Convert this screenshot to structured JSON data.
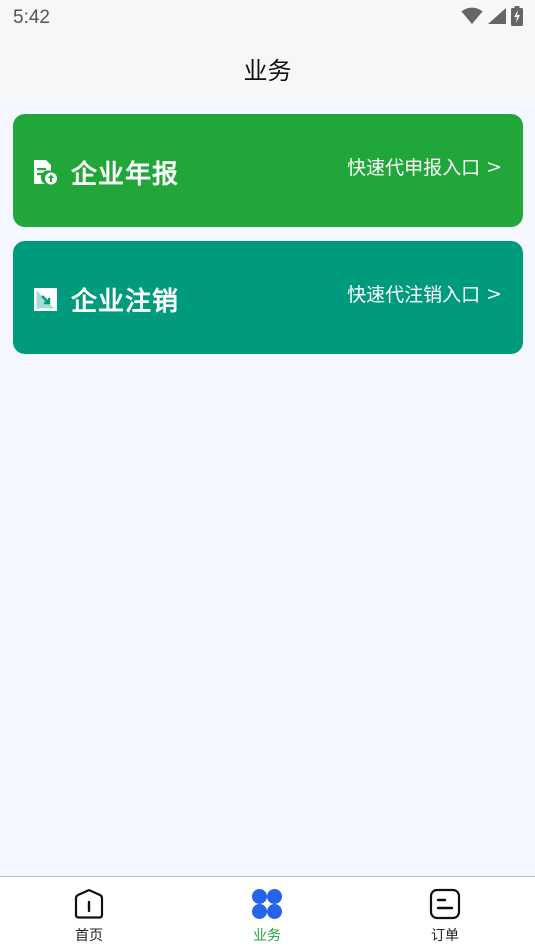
{
  "status_bar": {
    "time": "5:42",
    "icons": [
      "wifi-icon",
      "cellular-signal-icon",
      "battery-charging-icon"
    ]
  },
  "header": {
    "title": "业务"
  },
  "cards": [
    {
      "title": "企业年报",
      "link_label": "快速代申报入口",
      "chevron": ">",
      "icon": "report-upload-icon",
      "color": "#21a63a"
    },
    {
      "title": "企业注销",
      "link_label": "快速代注销入口",
      "chevron": ">",
      "icon": "deregister-icon",
      "color": "#009a7c"
    }
  ],
  "tab_bar": {
    "active_color": "#21a63a",
    "items": [
      {
        "label": "首页",
        "icon": "home-icon",
        "active": false
      },
      {
        "label": "业务",
        "icon": "business-grid-icon",
        "active": true
      },
      {
        "label": "订单",
        "icon": "orders-icon",
        "active": false
      }
    ]
  }
}
